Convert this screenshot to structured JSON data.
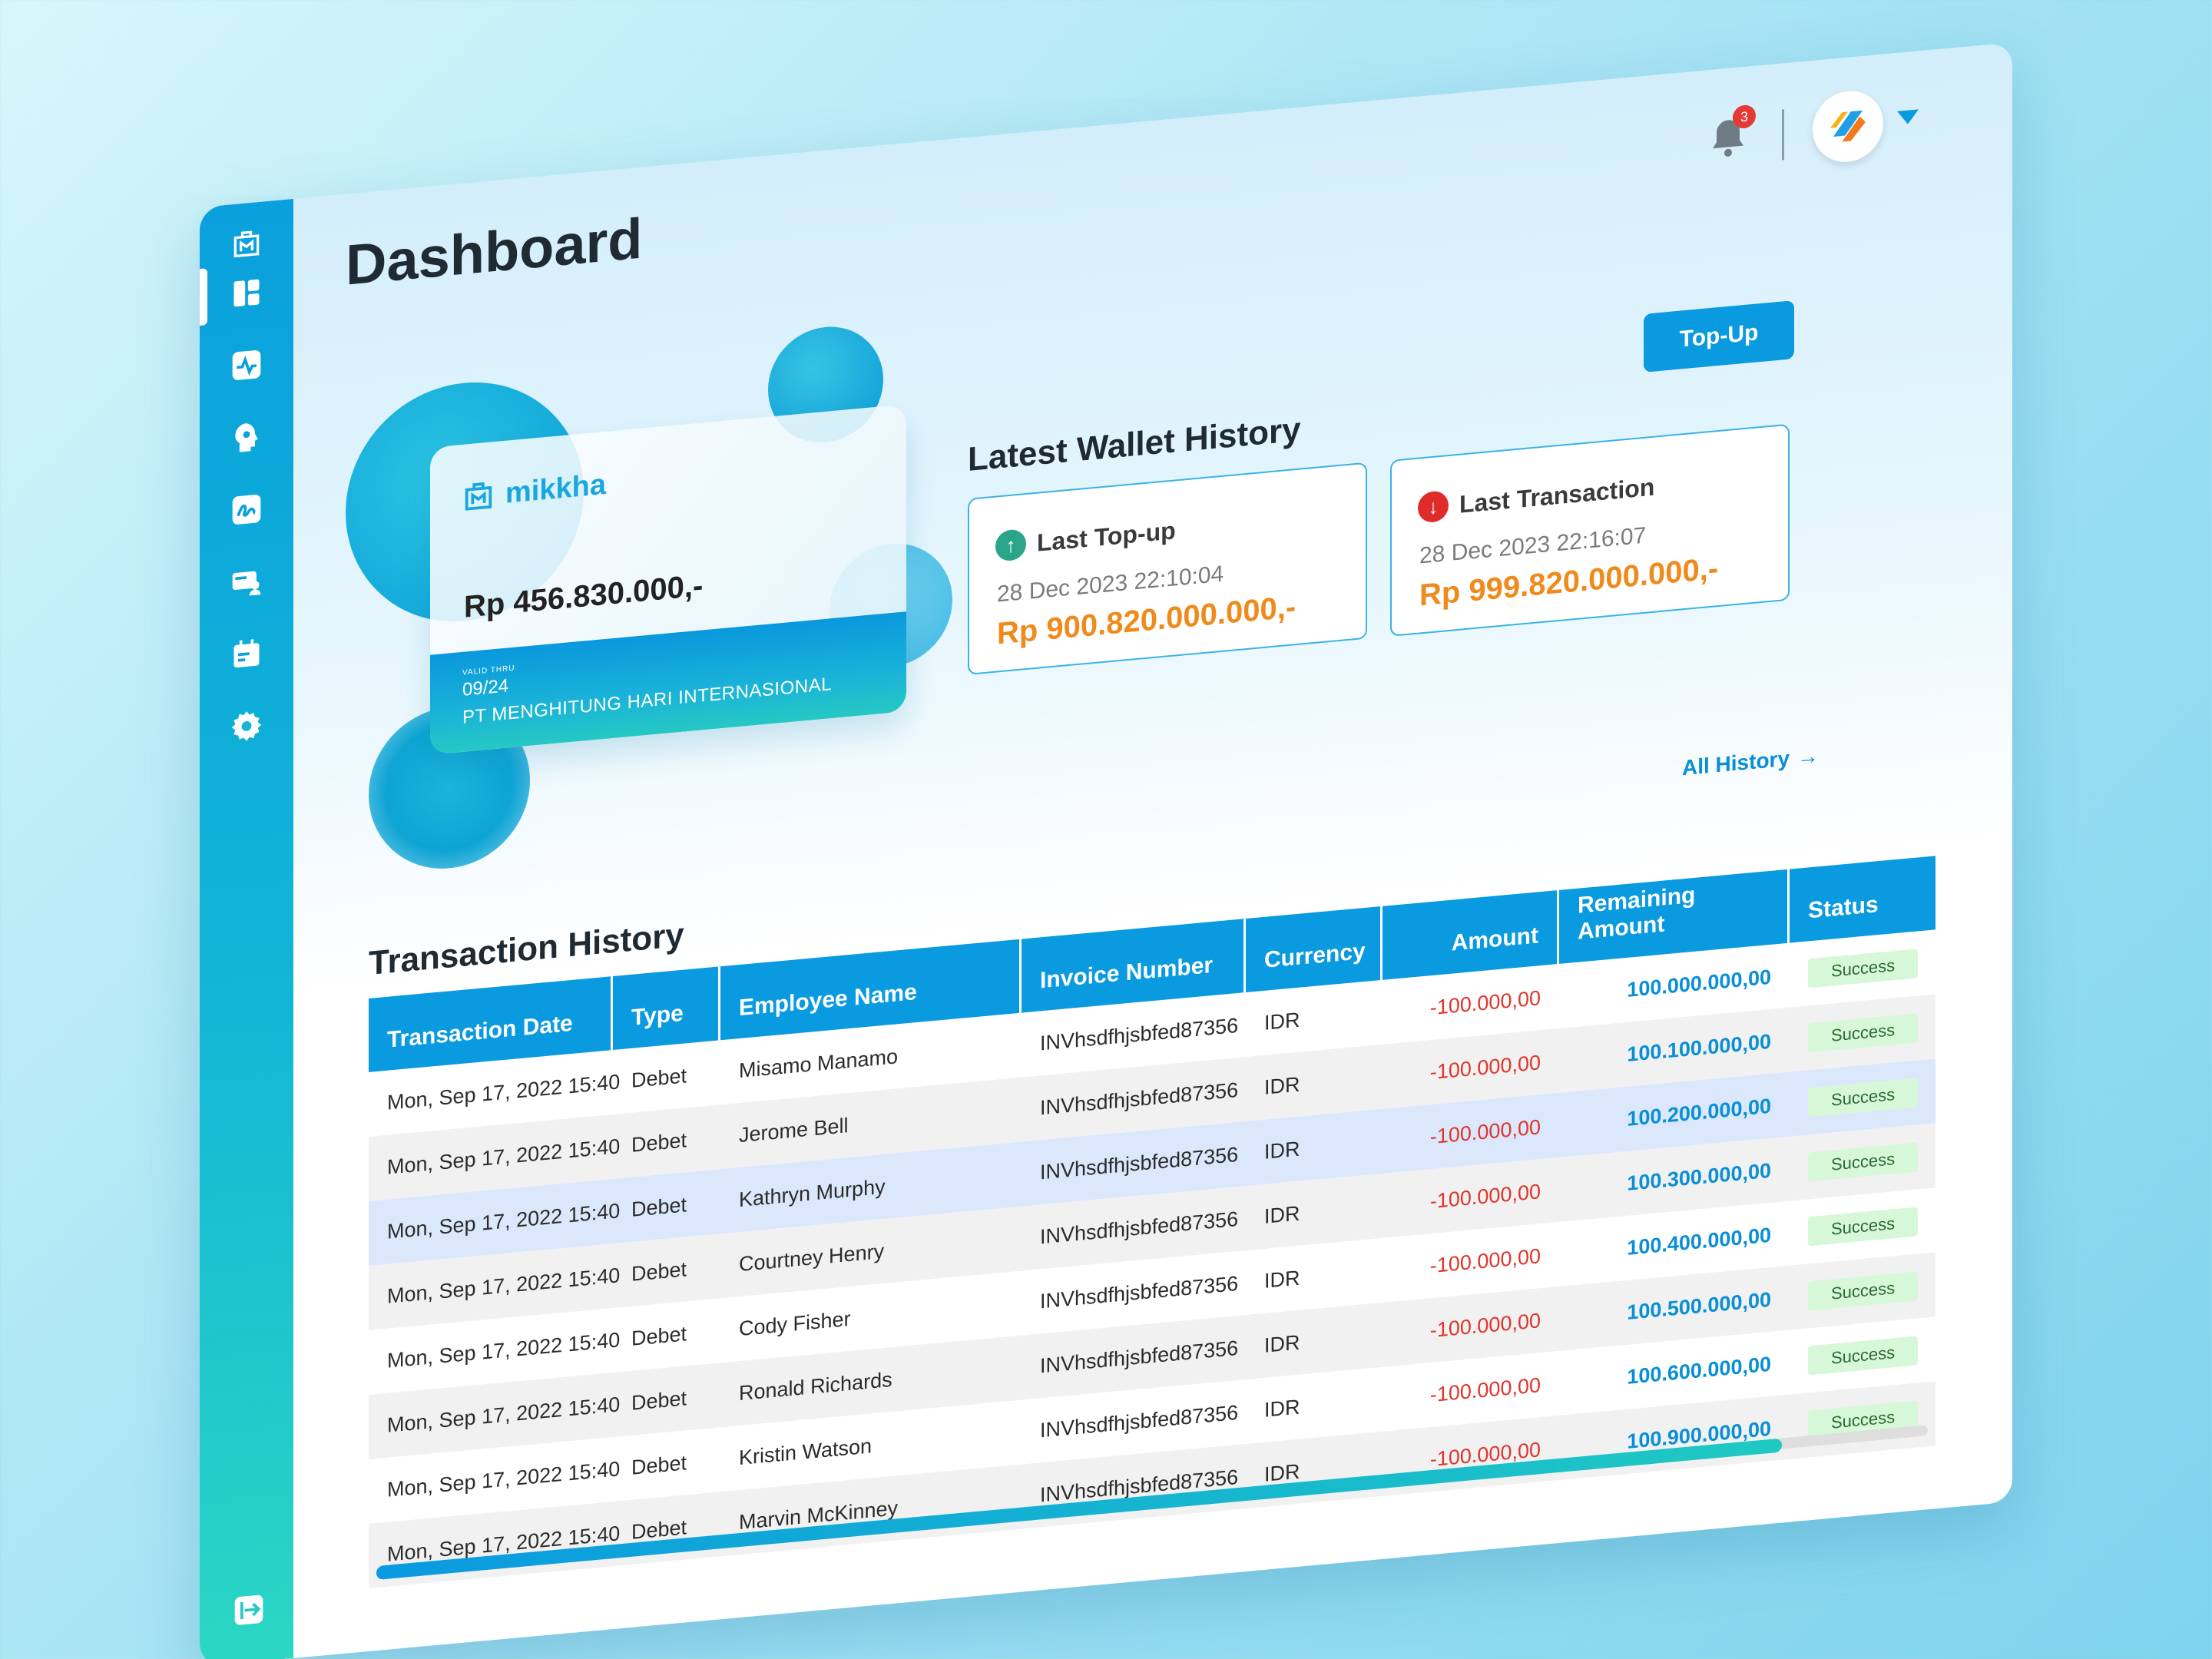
{
  "page": {
    "title": "Dashboard"
  },
  "sidebar": {
    "items": [
      {
        "name": "logo",
        "icon": "mikkha-logo-icon"
      },
      {
        "name": "dashboard",
        "icon": "dashboard-grid-icon",
        "active": true
      },
      {
        "name": "activity",
        "icon": "activity-pulse-icon"
      },
      {
        "name": "mind",
        "icon": "head-gear-icon"
      },
      {
        "name": "sign",
        "icon": "signature-icon"
      },
      {
        "name": "users-card",
        "icon": "card-user-icon"
      },
      {
        "name": "calendar",
        "icon": "calendar-card-icon"
      },
      {
        "name": "settings",
        "icon": "gear-icon"
      }
    ],
    "logout_icon": "logout-icon"
  },
  "topbar": {
    "notification_count": "3",
    "avatar_icon": "company-logo-icon"
  },
  "card": {
    "brand": "mikkha",
    "balance": "Rp 456.830.000,-",
    "valid_label": "VALID THRU",
    "valid_thru": "09/24",
    "company": "PT MENGHITUNG HARI INTERNASIONAL"
  },
  "wallet": {
    "title": "Latest Wallet History",
    "topup_label": "Top-Up",
    "last_topup": {
      "label": "Last Top-up",
      "date": "28 Dec 2023 22:10:04",
      "amount": "Rp 900.820.000.000,-"
    },
    "last_transaction": {
      "label": "Last Transaction",
      "date": "28 Dec 2023 22:16:07",
      "amount": "Rp 999.820.000.000,-"
    }
  },
  "history": {
    "title": "Transaction History",
    "all_history_label": "All History",
    "columns": [
      "Transaction Date",
      "Type",
      "Employee Name",
      "Invoice Number",
      "Currency",
      "Amount",
      "Remaining Amount",
      "Status"
    ],
    "rows": [
      {
        "date": "Mon, Sep 17, 2022 15:40",
        "type": "Debet",
        "employee": "Misamo Manamo",
        "invoice": "INVhsdfhjsbfed87356",
        "currency": "IDR",
        "amount": "-100.000,00",
        "remaining": "100.000.000,00",
        "status": "Success"
      },
      {
        "date": "Mon, Sep 17, 2022 15:40",
        "type": "Debet",
        "employee": "Jerome Bell",
        "invoice": "INVhsdfhjsbfed87356",
        "currency": "IDR",
        "amount": "-100.000,00",
        "remaining": "100.100.000,00",
        "status": "Success"
      },
      {
        "date": "Mon, Sep 17, 2022 15:40",
        "type": "Debet",
        "employee": "Kathryn Murphy",
        "invoice": "INVhsdfhjsbfed87356",
        "currency": "IDR",
        "amount": "-100.000,00",
        "remaining": "100.200.000,00",
        "status": "Success"
      },
      {
        "date": "Mon, Sep 17, 2022 15:40",
        "type": "Debet",
        "employee": "Courtney Henry",
        "invoice": "INVhsdfhjsbfed87356",
        "currency": "IDR",
        "amount": "-100.000,00",
        "remaining": "100.300.000,00",
        "status": "Success"
      },
      {
        "date": "Mon, Sep 17, 2022 15:40",
        "type": "Debet",
        "employee": "Cody Fisher",
        "invoice": "INVhsdfhjsbfed87356",
        "currency": "IDR",
        "amount": "-100.000,00",
        "remaining": "100.400.000,00",
        "status": "Success"
      },
      {
        "date": "Mon, Sep 17, 2022 15:40",
        "type": "Debet",
        "employee": "Ronald Richards",
        "invoice": "INVhsdfhjsbfed87356",
        "currency": "IDR",
        "amount": "-100.000,00",
        "remaining": "100.500.000,00",
        "status": "Success"
      },
      {
        "date": "Mon, Sep 17, 2022 15:40",
        "type": "Debet",
        "employee": "Kristin Watson",
        "invoice": "INVhsdfhjsbfed87356",
        "currency": "IDR",
        "amount": "-100.000,00",
        "remaining": "100.600.000,00",
        "status": "Success"
      },
      {
        "date": "Mon, Sep 17, 2022 15:40",
        "type": "Debet",
        "employee": "Marvin McKinney",
        "invoice": "INVhsdfhjsbfed87356",
        "currency": "IDR",
        "amount": "-100.000,00",
        "remaining": "100.900.000,00",
        "status": "Success"
      }
    ]
  },
  "colors": {
    "primary": "#0a9ae0",
    "teal": "#25c8c4",
    "amount_orange": "#f08a1c",
    "negative_red": "#e0352b",
    "success_bg": "#d7f7d9",
    "topup_icon": "#2aa58a",
    "transaction_icon": "#e02b2b"
  }
}
